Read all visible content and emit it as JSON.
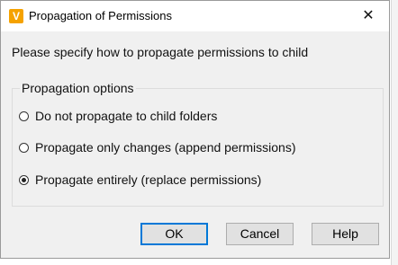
{
  "window": {
    "title": "Propagation of Permissions",
    "app_icon_letter": "V",
    "close_glyph": "✕"
  },
  "prompt": "Please specify how to propagate permissions to child",
  "group": {
    "title": "Propagation options",
    "options": [
      {
        "label": "Do not propagate to child folders",
        "selected": false
      },
      {
        "label": "Propagate only changes (append permissions)",
        "selected": false
      },
      {
        "label": "Propagate entirely (replace permissions)",
        "selected": true
      }
    ]
  },
  "buttons": {
    "ok": "OK",
    "cancel": "Cancel",
    "help": "Help"
  },
  "colors": {
    "accent": "#0078d7",
    "app_icon": "#f5a200"
  }
}
